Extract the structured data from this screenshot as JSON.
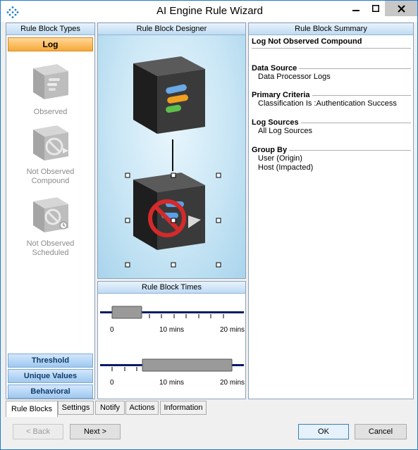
{
  "window": {
    "title": "AI Engine Rule Wizard"
  },
  "left_panel": {
    "header": "Rule Block Types",
    "active_category": "Log",
    "blocks": [
      {
        "label_lines": [
          "Observed"
        ]
      },
      {
        "label_lines": [
          "Not Observed",
          "Compound"
        ]
      },
      {
        "label_lines": [
          "Not Observed",
          "Scheduled"
        ]
      }
    ],
    "categories": [
      "Threshold",
      "Unique Values",
      "Behavioral"
    ]
  },
  "designer": {
    "header": "Rule Block Designer"
  },
  "times": {
    "header": "Rule Block Times",
    "slider1": {
      "ticks": [
        "0",
        "10 mins",
        "20 mins"
      ]
    },
    "slider2": {
      "ticks": [
        "0",
        "10 mins",
        "20 mins"
      ]
    }
  },
  "summary": {
    "header": "Rule Block Summary",
    "title": "Log Not Observed Compound",
    "sections": [
      {
        "heading": "Data Source",
        "values": [
          "Data Processor Logs"
        ]
      },
      {
        "heading": "Primary Criteria",
        "values": [
          "Classification Is :Authentication Success"
        ]
      },
      {
        "heading": "Log Sources",
        "values": [
          "All Log Sources"
        ]
      },
      {
        "heading": "Group By",
        "values": [
          "User (Origin)",
          "Host (Impacted)"
        ]
      }
    ]
  },
  "tabs": [
    "Rule Blocks",
    "Settings",
    "Notify",
    "Actions",
    "Information"
  ],
  "buttons": {
    "back": "< Back",
    "next": "Next >",
    "ok": "OK",
    "cancel": "Cancel"
  },
  "colors": {
    "accent": "#f7a937",
    "header_blue": "#bfdbf3",
    "close_gray": "#c7c7c7"
  }
}
